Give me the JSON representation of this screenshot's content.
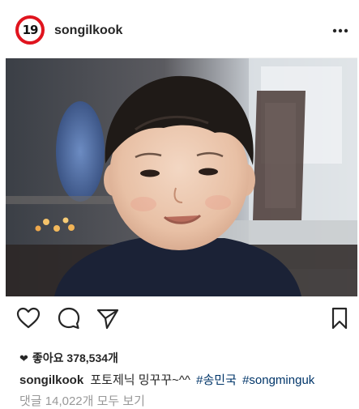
{
  "post": {
    "username": "songilkook",
    "avatar_text": "19",
    "more_icon": "ellipsis-icon"
  },
  "actions": {
    "like_icon": "heart-outline-icon",
    "comment_icon": "comment-bubble-icon",
    "share_icon": "paper-plane-icon",
    "save_icon": "bookmark-icon"
  },
  "likes": {
    "label": "좋아요 378,534개"
  },
  "caption": {
    "username": "songilkook",
    "text": "포토제닉 밍꾸꾸~^^",
    "hashtags": [
      "#송민국",
      "#songminguk"
    ]
  },
  "comments": {
    "label": "댓글 14,022개 모두 보기"
  },
  "colors": {
    "avatar_ring": "#e0141e",
    "hashtag": "#003569",
    "muted_text": "#999999"
  }
}
